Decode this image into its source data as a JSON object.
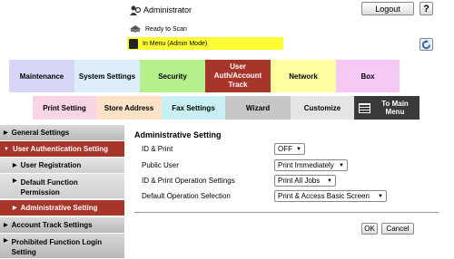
{
  "header": {
    "user": "Administrator",
    "logout": "Logout",
    "help": "?",
    "status": "Ready to Scan",
    "mode": "In Menu (Admin Mode)"
  },
  "tabs_top": [
    "Maintenance",
    "System Settings",
    "Security",
    "User Auth/Account Track",
    "Network",
    "Box"
  ],
  "tabs_bottom": [
    "Print Setting",
    "Store Address",
    "Fax Settings",
    "Wizard",
    "Customize",
    "To Main Menu"
  ],
  "sidebar": {
    "items": [
      "General Settings",
      "User Authentication Setting",
      "User Registration",
      "Default Function Permission",
      "Administrative Setting",
      "Account Track Settings",
      "Prohibited Function Login Setting"
    ]
  },
  "main": {
    "title": "Administrative Setting",
    "rows": [
      {
        "label": "ID & Print",
        "value": "OFF"
      },
      {
        "label": "Public User",
        "value": "Print Immediately"
      },
      {
        "label": "ID & Print Operation Settings",
        "value": "Print All Jobs"
      },
      {
        "label": "Default Operation Selection",
        "value": "Print & Access Basic Screen"
      }
    ],
    "ok": "OK",
    "cancel": "Cancel"
  },
  "colors": {
    "accent": "#a8352a",
    "mode_bar": "#ffff33",
    "tab_maintenance": "#d6d6f6",
    "tab_system": "#ddeefa",
    "tab_security": "#b5f08a",
    "tab_network": "#ffffa0",
    "tab_box": "#f6c8f6"
  }
}
